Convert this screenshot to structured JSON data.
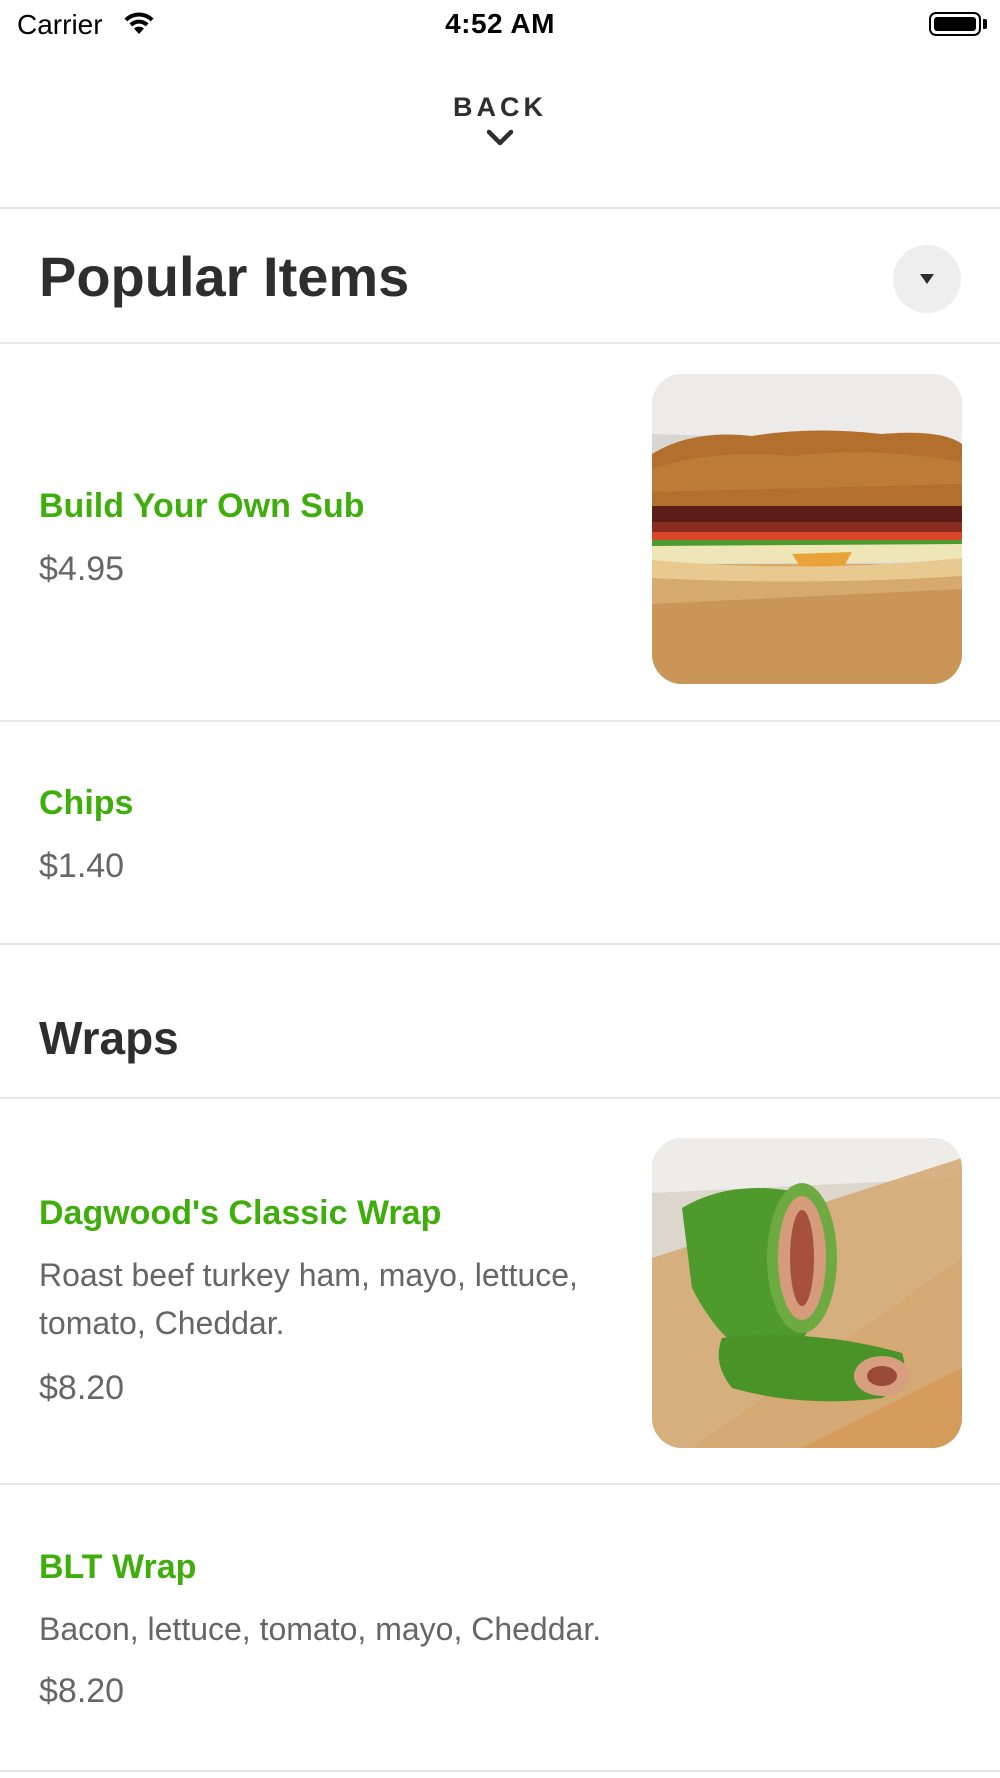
{
  "status_bar": {
    "carrier": "Carrier",
    "time": "4:52 AM"
  },
  "nav": {
    "back_label": "BACK"
  },
  "sections": [
    {
      "title": "Popular Items",
      "items": [
        {
          "name": "Build Your Own Sub",
          "price": "$4.95",
          "image": "sub-sandwich-photo"
        },
        {
          "name": "Chips",
          "price": "$1.40"
        }
      ]
    },
    {
      "title": "Wraps",
      "items": [
        {
          "name": "Dagwood's Classic Wrap",
          "description": "Roast beef turkey ham, mayo, lettuce, tomato, Cheddar.",
          "price": "$8.20",
          "image": "spinach-wrap-photo"
        },
        {
          "name": "BLT Wrap",
          "description": "Bacon, lettuce, tomato, mayo, Cheddar.",
          "price": "$8.20"
        }
      ]
    }
  ],
  "colors": {
    "accent": "#3fae0c",
    "text": "#2e2e2e",
    "muted": "#666666",
    "divider": "#e6e6e6"
  }
}
